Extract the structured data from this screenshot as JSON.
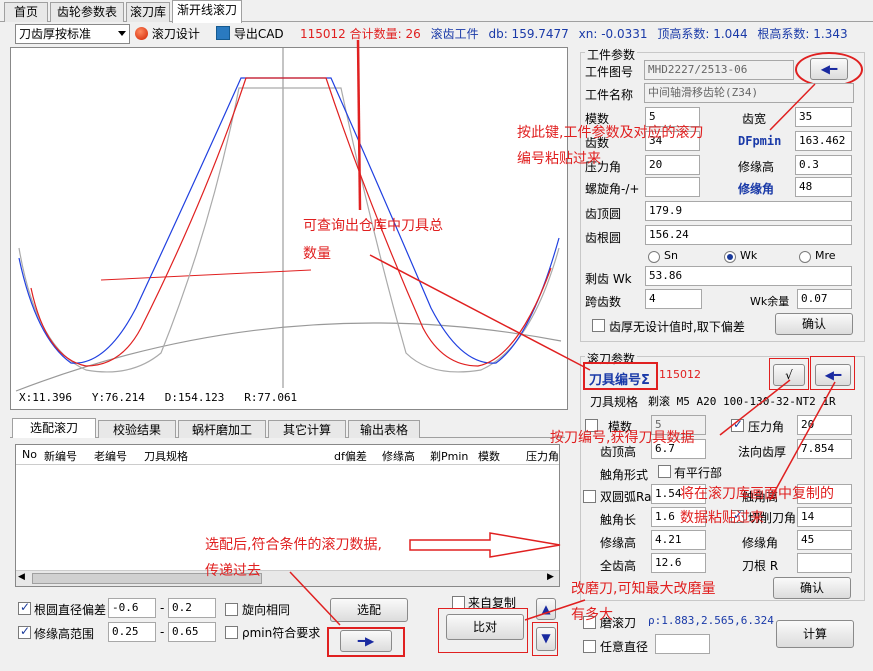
{
  "tabs": [
    "首页",
    "齿轮参数表",
    "滚刀库",
    "渐开线滚刀"
  ],
  "toolbar": {
    "mode_select": "刀齿厚按标准",
    "hob_design": "滚刀设计",
    "export_cad": "导出CAD"
  },
  "info_bar": {
    "code": "115012",
    "total_label": "合计数量:",
    "total": "26",
    "workpiece": "滚齿工件",
    "db": "db: 159.7477",
    "xn": "xn: -0.0331",
    "top_coef": "顶高系数: 1.044",
    "root_coef": "根高系数: 1.343"
  },
  "plot": {
    "coords": [
      "X:11.396",
      "Y:76.214",
      "D:154.123",
      "R:77.061"
    ]
  },
  "workpiece_params": {
    "title": "工件参数",
    "drawing_no_label": "工件图号",
    "drawing_no": "MHD2227/2513-06",
    "name_label": "工件名称",
    "name": "中间轴滑移齿轮(Z34)",
    "module_label": "模数",
    "module": "5",
    "face_width_label": "齿宽",
    "face_width": "35",
    "teeth_label": "齿数",
    "teeth": "34",
    "dfpmin_label": "DFpmin",
    "dfpmin": "163.462",
    "pressure_label": "压力角",
    "pressure": "20",
    "mod_height_label": "修缘高",
    "mod_height": "0.3",
    "helix_label": "螺旋角-/+",
    "helix": "",
    "mod_angle_label": "修缘角",
    "mod_angle": "48",
    "tip_circle_label": "齿顶圆",
    "tip_circle": "179.9",
    "root_circle_label": "齿根圆",
    "root_circle": "156.24",
    "radio_options": [
      "Sn",
      "Wk",
      "Mre"
    ],
    "span_label": "剩齿 Wk",
    "span": "53.86",
    "span_teeth_label": "跨齿数",
    "span_teeth": "4",
    "wk_allow_label": "Wk余量",
    "wk_allow": "0.07",
    "no_design_label": "齿厚无设计值时,取下偏差",
    "confirm": "确认"
  },
  "hob_params": {
    "title": "滚刀参数",
    "hob_no_label": "刀具编号Σ",
    "hob_no": "115012",
    "spec_label": "刀具规格",
    "spec": "剃滚 M5 A20 100-130-32-NT2 1R",
    "module_label": "模数",
    "module": "5",
    "pressure_label": "压力角",
    "pressure": "20",
    "tooth_top_label": "齿顶高",
    "tooth_top": "6.7",
    "normal_thick_label": "法向齿厚",
    "normal_thick": "7.854",
    "tip_form_label": "触角形式",
    "parallel_label": "有平行部",
    "double_arc_label": "双圆弧Ra",
    "double_arc": "1.54",
    "tip_height_label": "触角高",
    "tip_height": "",
    "tip_len_label": "触角长",
    "tip_len": "1.6",
    "cut_angle_label": "切削刀角",
    "cut_angle": "14",
    "mod_height_label": "修缘高",
    "mod_height": "4.21",
    "mod_angle_label": "修缘角",
    "mod_angle": "45",
    "full_height_label": "全齿高",
    "full_height": "12.6",
    "root_r_label": "刀根 R",
    "root_r": "",
    "confirm": "确认"
  },
  "bottom_right": {
    "grind_label": "磨滚刀",
    "rho_values": "ρ:1.883,2.565,6.324",
    "any_dia_label": "任意直径",
    "calc": "计算"
  },
  "lower_tabs": [
    "选配滚刀",
    "校验结果",
    "蜗杆磨加工",
    "其它计算",
    "输出表格"
  ],
  "grid_headers": [
    "No",
    "新编号",
    "老编号",
    "刀具规格",
    "df偏差",
    "修缘高",
    "剃Pmin",
    "模数",
    "压力角"
  ],
  "filters": {
    "root_dev_label": "根圆直径偏差",
    "root_dev_min": "-0.6",
    "root_dev_max": "0.2",
    "mod_range_label": "修缘高范围",
    "mod_range_min": "0.25",
    "mod_range_max": "0.65",
    "same_rot_label": "旋向相同",
    "rho_min_label": "ρmin符合要求",
    "select_btn": "选配",
    "from_copy_label": "来自复制",
    "compare_btn": "比对"
  },
  "annotations": {
    "paste_key": "按此键,工件参数及对应的滚刀编号粘贴过来",
    "paste_key_1": "按此键,工件参数及对应的滚刀",
    "paste_key_2": "编号粘贴过来",
    "stock_query_1": "可查询出仓库中刀具总",
    "stock_query_2": "数量",
    "get_hob_data": "按刀编号,获得刀具数据",
    "paste_from_lib_1": "将在滚刀库画面中复制的",
    "paste_from_lib_2": "数据粘贴过来",
    "after_select_1": "选配后,符合条件的滚刀数据,",
    "after_select_2": "传递过去",
    "regrind_1": "改磨刀,可知最大改磨量",
    "regrind_2": "有多大"
  }
}
